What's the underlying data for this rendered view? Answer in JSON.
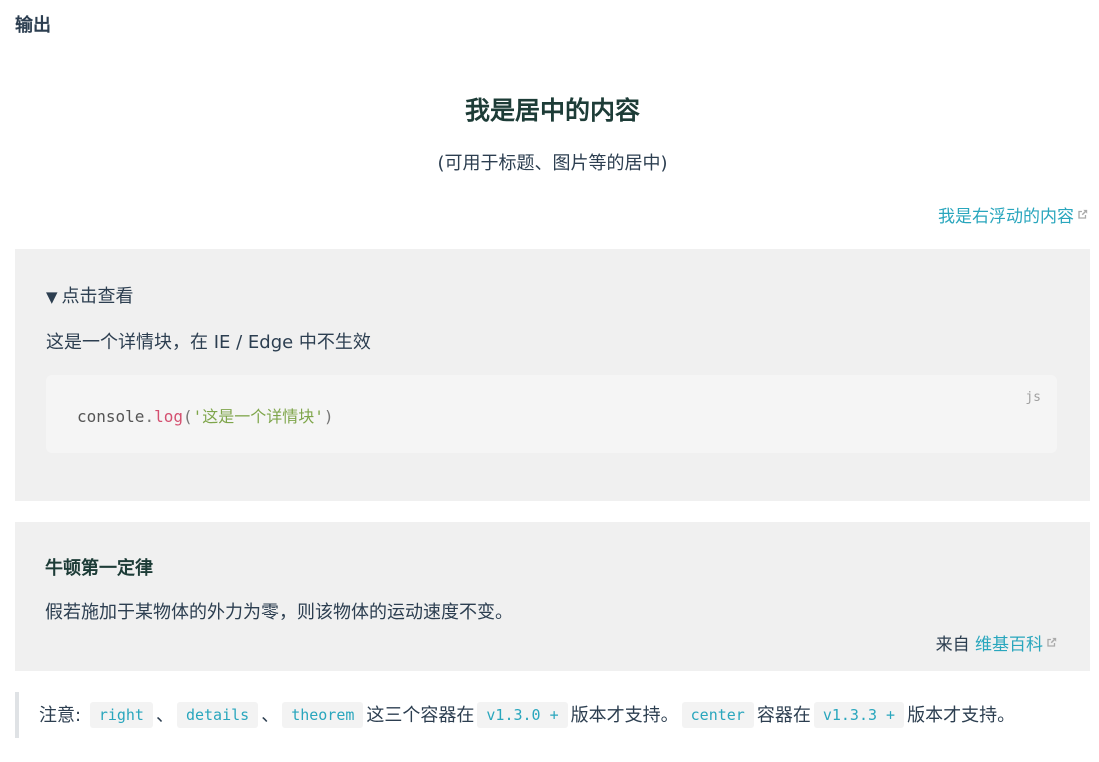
{
  "heading": "输出",
  "center": {
    "title": "我是居中的内容",
    "subtitle": "(可用于标题、图片等的居中)"
  },
  "right": {
    "link_text": "我是右浮动的内容"
  },
  "details": {
    "summary_marker": "▼",
    "summary": "点击查看",
    "text": "这是一个详情块，在 IE / Edge 中不生效",
    "code": {
      "lang": "js",
      "object": "console",
      "dot": ".",
      "method": "log",
      "open": "(",
      "string": "'这是一个详情块'",
      "close": ")"
    }
  },
  "theorem": {
    "title": "牛顿第一定律",
    "text": "假若施加于某物体的外力为零，则该物体的运动速度不变。",
    "source_prefix": "来自",
    "source_link": "维基百科"
  },
  "note": {
    "label": "注意:",
    "chip1": "right",
    "sep1": "、",
    "chip2": "details",
    "sep2": "、",
    "chip3": "theorem",
    "text1": "这三个容器在",
    "chip4": "v1.3.0 +",
    "text2": "版本才支持。",
    "chip5": "center",
    "text3": "容器在",
    "chip6": "v1.3.3 +",
    "text4": "版本才支持。"
  },
  "colors": {
    "accent": "#29a6bd",
    "container_bg": "#f0f0f0",
    "text": "#2c3e50"
  }
}
